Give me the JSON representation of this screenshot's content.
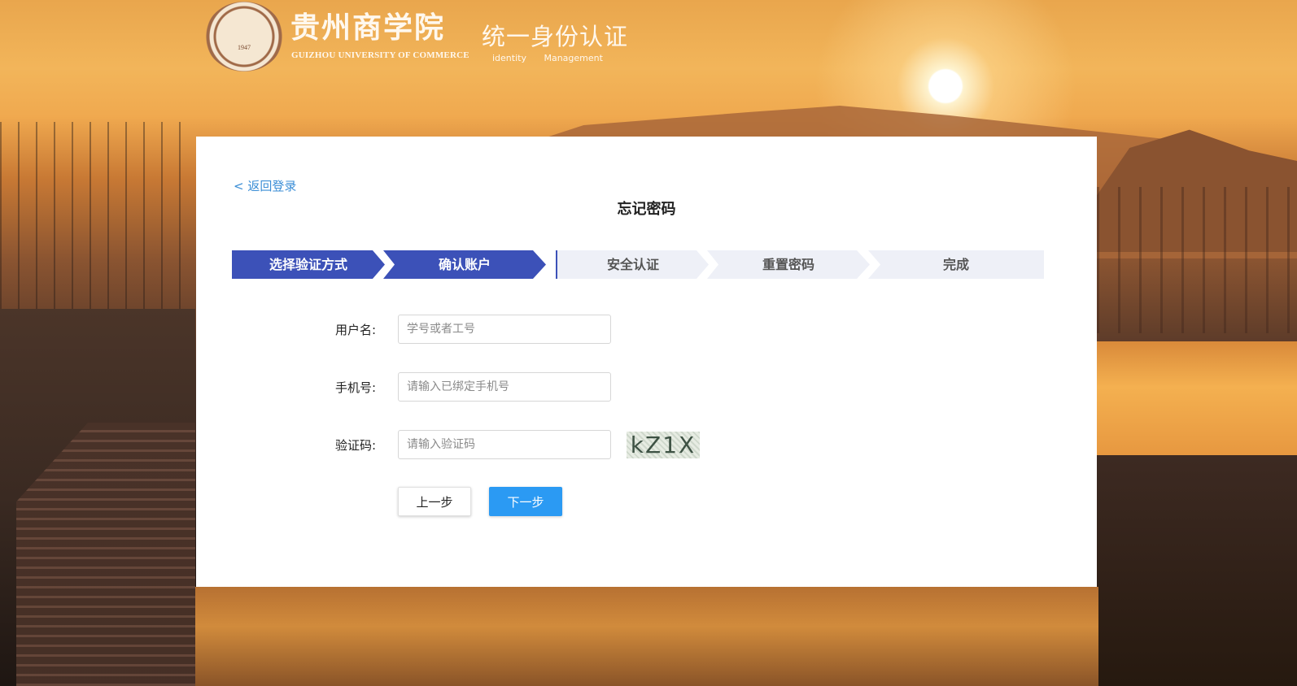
{
  "header": {
    "seal_year": "1947",
    "brand_cn": "贵州商学院",
    "brand_en": "GUIZHOU UNIVERSITY OF COMMERCE",
    "system_title": "统一身份认证",
    "system_subtitle": "identity Management"
  },
  "panel": {
    "back_link": "< 返回登录",
    "title": "忘记密码",
    "steps": [
      {
        "label": "选择验证方式",
        "state": "done"
      },
      {
        "label": "确认账户",
        "state": "done"
      },
      {
        "label": "安全认证",
        "state": "todo"
      },
      {
        "label": "重置密码",
        "state": "todo"
      },
      {
        "label": "完成",
        "state": "todo"
      }
    ],
    "form": {
      "username_label": "用户名:",
      "username_placeholder": "学号或者工号",
      "phone_label": "手机号:",
      "phone_placeholder": "请输入已绑定手机号",
      "captcha_label": "验证码:",
      "captcha_placeholder": "请输入验证码",
      "captcha_text": "kZ1X"
    },
    "buttons": {
      "prev": "上一步",
      "next": "下一步"
    }
  },
  "colors": {
    "step_done": "#3c51b8",
    "step_todo": "#eef0f7",
    "primary_button": "#2b9af3",
    "link": "#3b8ed6"
  }
}
